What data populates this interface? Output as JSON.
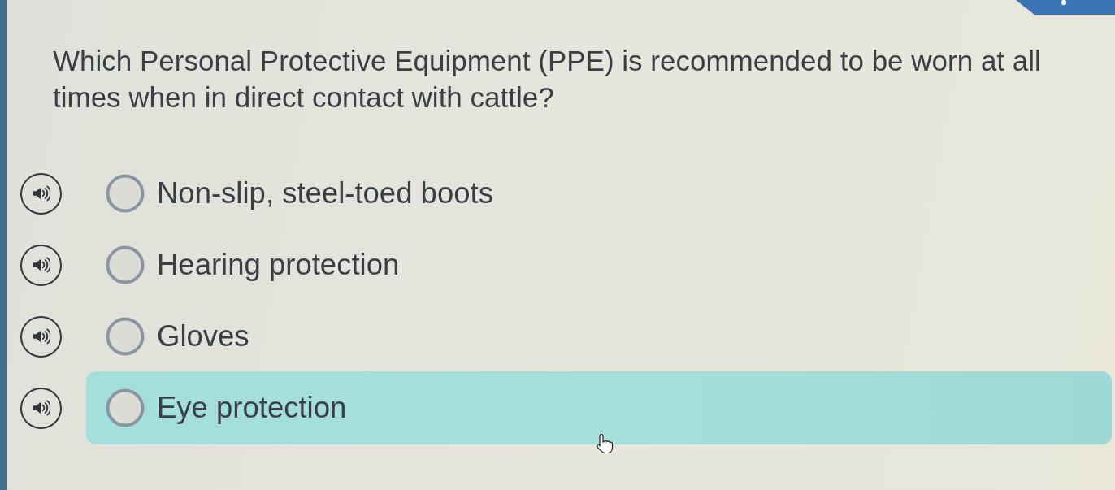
{
  "question": "Which Personal Protective Equipment (PPE) is recommended to be worn at all times when in direct contact with cattle?",
  "options": [
    {
      "label": "Non-slip, steel-toed boots",
      "selected": false,
      "hovered": false
    },
    {
      "label": "Hearing protection",
      "selected": false,
      "hovered": false
    },
    {
      "label": "Gloves",
      "selected": false,
      "hovered": false
    },
    {
      "label": "Eye protection",
      "selected": false,
      "hovered": true
    }
  ]
}
